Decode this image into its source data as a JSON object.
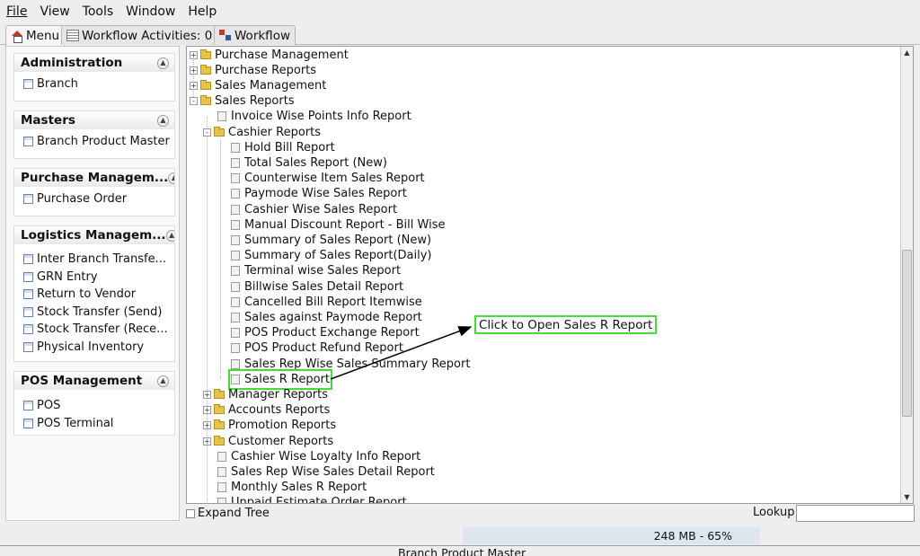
{
  "menubar": {
    "items": [
      {
        "label": "File"
      },
      {
        "label": "View"
      },
      {
        "label": "Tools"
      },
      {
        "label": "Window"
      },
      {
        "label": "Help"
      }
    ]
  },
  "tabs": [
    {
      "label": "Menu"
    },
    {
      "label": "Workflow Activities: 0"
    },
    {
      "label": "Workflow"
    }
  ],
  "sidebar": {
    "sections": [
      {
        "title": "Administration",
        "items": [
          {
            "label": "Branch"
          }
        ]
      },
      {
        "title": "Masters",
        "items": [
          {
            "label": "Branch Product Master"
          }
        ]
      },
      {
        "title": "Purchase Managem...",
        "items": [
          {
            "label": "Purchase Order"
          }
        ]
      },
      {
        "title": "Logistics Managem...",
        "items": [
          {
            "label": "Inter Branch Transfe..."
          },
          {
            "label": "GRN Entry"
          },
          {
            "label": "Return to Vendor"
          },
          {
            "label": "Stock Transfer (Send)"
          },
          {
            "label": "Stock Transfer (Rece..."
          },
          {
            "label": "Physical Inventory"
          }
        ]
      },
      {
        "title": "POS Management",
        "items": [
          {
            "label": "POS"
          },
          {
            "label": "POS Terminal"
          }
        ]
      }
    ]
  },
  "tree": {
    "nodes": [
      {
        "label": "Purchase Management",
        "level": 0,
        "kind": "folder",
        "expander": "+"
      },
      {
        "label": "Purchase Reports",
        "level": 0,
        "kind": "folder",
        "expander": "+"
      },
      {
        "label": "Sales Management",
        "level": 0,
        "kind": "folder",
        "expander": "+"
      },
      {
        "label": "Sales Reports",
        "level": 0,
        "kind": "folder-open",
        "expander": "-"
      },
      {
        "label": "Invoice Wise Points Info Report",
        "level": 1,
        "kind": "doc"
      },
      {
        "label": "Cashier Reports",
        "level": 1,
        "kind": "folder-open",
        "expander": "-"
      },
      {
        "label": "Hold Bill Report",
        "level": 2,
        "kind": "doc"
      },
      {
        "label": "Total Sales Report (New)",
        "level": 2,
        "kind": "doc"
      },
      {
        "label": "Counterwise Item Sales Report",
        "level": 2,
        "kind": "doc"
      },
      {
        "label": "Paymode Wise Sales Report",
        "level": 2,
        "kind": "doc"
      },
      {
        "label": "Cashier Wise Sales Report",
        "level": 2,
        "kind": "doc"
      },
      {
        "label": "Manual Discount Report - Bill Wise",
        "level": 2,
        "kind": "doc"
      },
      {
        "label": "Summary of Sales Report (New)",
        "level": 2,
        "kind": "doc"
      },
      {
        "label": "Summary of Sales Report(Daily)",
        "level": 2,
        "kind": "doc"
      },
      {
        "label": "Terminal wise Sales Report",
        "level": 2,
        "kind": "doc"
      },
      {
        "label": "Billwise Sales Detail Report",
        "level": 2,
        "kind": "doc"
      },
      {
        "label": "Cancelled Bill Report Itemwise",
        "level": 2,
        "kind": "doc"
      },
      {
        "label": "Sales against Paymode Report",
        "level": 2,
        "kind": "doc"
      },
      {
        "label": "POS Product Exchange Report",
        "level": 2,
        "kind": "doc"
      },
      {
        "label": "POS Product Refund Report",
        "level": 2,
        "kind": "doc"
      },
      {
        "label": "Sales Rep Wise Sales Summary Report",
        "level": 2,
        "kind": "doc"
      },
      {
        "label": "Sales R Report",
        "level": 2,
        "kind": "doc",
        "highlighted": true
      },
      {
        "label": "Manager Reports",
        "level": 1,
        "kind": "folder",
        "expander": "+"
      },
      {
        "label": "Accounts Reports",
        "level": 1,
        "kind": "folder",
        "expander": "+"
      },
      {
        "label": "Promotion Reports",
        "level": 1,
        "kind": "folder",
        "expander": "+"
      },
      {
        "label": "Customer Reports",
        "level": 1,
        "kind": "folder",
        "expander": "+"
      },
      {
        "label": "Cashier Wise Loyalty Info Report",
        "level": 1,
        "kind": "doc"
      },
      {
        "label": "Sales Rep Wise Sales Detail Report",
        "level": 1,
        "kind": "doc"
      },
      {
        "label": "Monthly Sales R Report",
        "level": 1,
        "kind": "doc"
      },
      {
        "label": "Unpaid Estimate Order Report",
        "level": 1,
        "kind": "doc"
      }
    ]
  },
  "bottom": {
    "expand_tree_label": "Expand Tree",
    "lookup_label": "Lookup",
    "lookup_value": "",
    "memory_text": "248 MB - 65%",
    "status_text": "Branch Product Master"
  },
  "annotation": {
    "callout_text": "Click to Open Sales R Report",
    "highlight_color": "#44dd33"
  },
  "icons": {
    "menu_tab": "home-icon",
    "activities_tab": "list-icon",
    "workflow_tab": "workflow-icon",
    "section_toggle": "collapse-icon",
    "sidebar_item": "window-icon",
    "tree_folder": "folder-icon",
    "tree_leaf": "document-icon"
  }
}
